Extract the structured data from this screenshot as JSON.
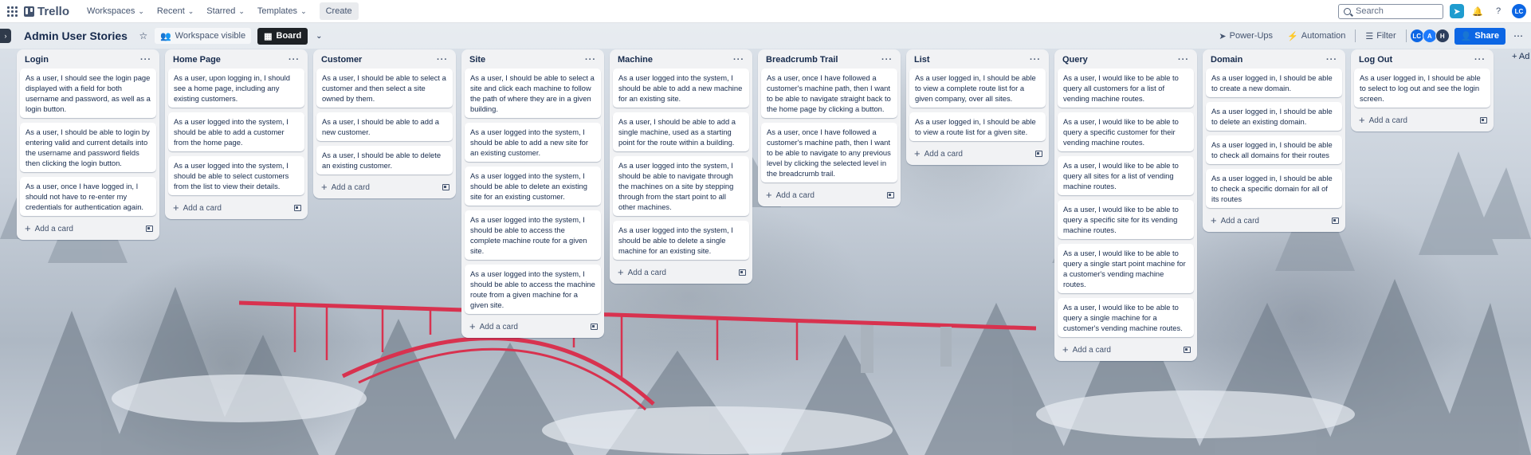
{
  "topnav": {
    "logo": "Trello",
    "menus": [
      {
        "label": "Workspaces"
      },
      {
        "label": "Recent"
      },
      {
        "label": "Starred"
      },
      {
        "label": "Templates"
      }
    ],
    "create_label": "Create",
    "search_placeholder": "Search",
    "user_initials": "LC"
  },
  "board": {
    "title": "Admin User Stories",
    "visibility_label": "Workspace visible",
    "view_label": "Board",
    "powerups_label": "Power-Ups",
    "automation_label": "Automation",
    "filter_label": "Filter",
    "members": [
      {
        "initials": "LC",
        "color": "#0c66e4"
      },
      {
        "initials": "A",
        "color": "#1d7afc"
      },
      {
        "initials": "H",
        "color": "#2c3e5d"
      }
    ],
    "share_label": "Share",
    "add_list_label": "+ Ad"
  },
  "add_card_label": "Add a card",
  "lists": [
    {
      "title": "Login",
      "cards": [
        "As a user, I should see the login page displayed with a field for both username and password, as well as a login button.",
        "As a user, I should be able to login by entering valid and current details into the username and password fields then clicking the login button.",
        "As a user, once I have logged in, I should not have to re-enter my credentials for authentication again."
      ]
    },
    {
      "title": "Home Page",
      "cards": [
        "As a user, upon logging in, I should see a home page, including any existing customers.",
        "As a user logged into the system, I should be able to add a customer from the home page.",
        "As a user logged into the system, I should be able to select customers from the list to view their details."
      ]
    },
    {
      "title": "Customer",
      "cards": [
        "As a user, I should be able to select a customer and then select a site owned by them.",
        "As a user, I should be able to add a new customer.",
        "As a user, I should be able to delete an existing customer."
      ]
    },
    {
      "title": "Site",
      "cards": [
        "As a user, I should be able to select a site and click each machine to follow the path of where they are in a given building.",
        "As a user logged into the system, I should be able to add a new site for an existing customer.",
        "As a user logged into the system, I should be able to delete an existing site for an existing customer.",
        "As a user logged into the system, I should be able to access the complete machine route for a given site.",
        "As a user logged into the system, I should be able to access the machine route from a given machine for a given site."
      ]
    },
    {
      "title": "Machine",
      "cards": [
        "As a user logged into the system, I should be able to add a new machine for an existing site.",
        "As a user, I should be able to add a single machine, used as a starting point for the route within a building.",
        "As a user logged into the system, I should be able to navigate through the machines on a site by stepping through from the start point to all other machines.",
        "As a user logged into the system, I should be able to delete a single machine for an existing site."
      ]
    },
    {
      "title": "Breadcrumb Trail",
      "cards": [
        "As a user, once I have followed a customer's machine path, then I want to be able to navigate straight back to the home page by clicking a button.",
        "As a user, once I have followed a customer's machine path, then I want to be able to navigate to any previous level by clicking the selected level in the breadcrumb trail."
      ]
    },
    {
      "title": "List",
      "cards": [
        "As a user logged in, I should be able to view a complete route list for a given company, over all sites.",
        "As a user logged in, I should be able to view a route list for a given site."
      ]
    },
    {
      "title": "Query",
      "cards": [
        "As a user, I would like to be able to query all customers for a list of vending machine routes.",
        "As a user, I would like to be able to query a specific customer for their vending machine routes.",
        "As a user, I would like to be able to query all sites for a list of vending machine routes.",
        "As a user, I would like to be able to query a specific site for its vending machine routes.",
        "As a user, I would like to be able to query a single start point machine for a customer's vending machine routes.",
        "As a user, I would like to be able to query a single machine for a customer's vending machine routes."
      ]
    },
    {
      "title": "Domain",
      "cards": [
        "As a user logged in, I should be able to create a new domain.",
        "As a user logged in, I should be able to delete an existing domain.",
        "As a user logged in, I should be able to check all domains for their routes",
        "As a user logged in, I should be able to check a specific domain for all of its routes"
      ]
    },
    {
      "title": "Log Out",
      "cards": [
        "As a user logged in, I should be able to select to log out and see the login screen."
      ]
    }
  ]
}
